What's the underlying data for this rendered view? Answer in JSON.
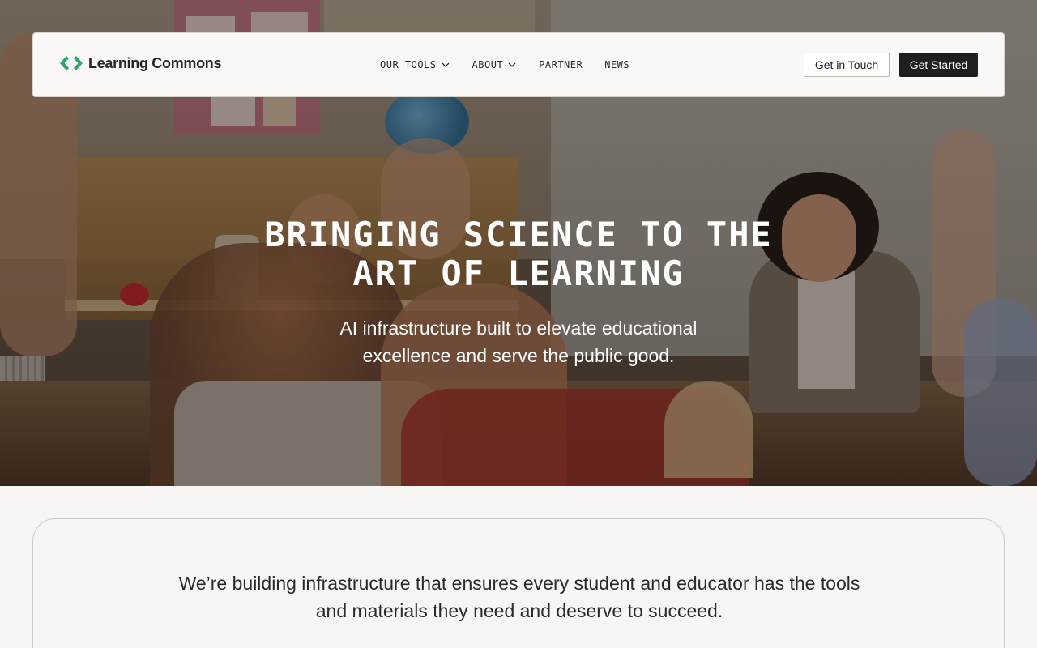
{
  "brand": {
    "name": "Learning Commons",
    "logo_icon": "code-brackets-logo",
    "logo_color": "#2ea66b"
  },
  "nav": {
    "items": [
      {
        "label": "OUR TOOLS",
        "has_dropdown": true
      },
      {
        "label": "ABOUT",
        "has_dropdown": true
      },
      {
        "label": "PARTNER",
        "has_dropdown": false
      },
      {
        "label": "NEWS",
        "has_dropdown": false
      }
    ],
    "secondary_button": "Get in Touch",
    "primary_button": "Get Started"
  },
  "hero": {
    "title_line1": "BRINGING SCIENCE TO THE",
    "title_line2": "ART OF LEARNING",
    "subtitle_line1": "AI infrastructure built to elevate educational",
    "subtitle_line2": "excellence and serve the public good.",
    "image": "classroom-photo"
  },
  "mission": {
    "line1": "We’re building infrastructure that ensures every student and educator has the tools",
    "line2": "and materials they need and deserve to succeed."
  },
  "colors": {
    "primary_button_bg": "#1f1f1f",
    "page_bg": "#f7f6f4"
  }
}
